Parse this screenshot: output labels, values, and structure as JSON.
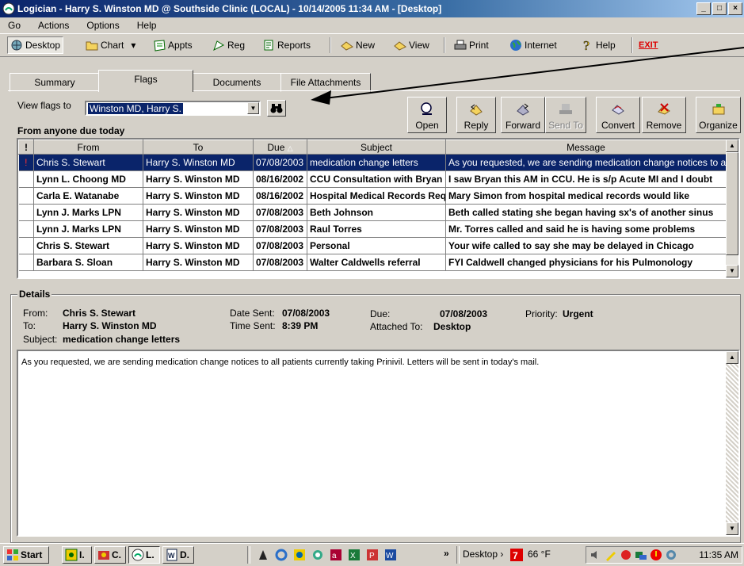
{
  "window": {
    "title": "Logician  -  Harry S. Winston MD @ Southside Clinic (LOCAL)  -  10/14/2005  11:34 AM - [Desktop]",
    "controls": [
      "_",
      "□",
      "×"
    ]
  },
  "menu": [
    "Go",
    "Actions",
    "Options",
    "Help"
  ],
  "toolbar": {
    "desktop": "Desktop",
    "chart": "Chart",
    "chart_dropdown": "▾",
    "appts": "Appts",
    "reg": "Reg",
    "reports": "Reports",
    "new": "New",
    "view": "View",
    "print": "Print",
    "internet": "Internet",
    "help": "Help",
    "exit": "EXIT"
  },
  "tabs": [
    "Summary",
    "Flags",
    "Documents",
    "File Attachments"
  ],
  "active_tab": "Flags",
  "filter": {
    "label": "View flags to",
    "value": "Winston MD, Harry S.",
    "caption": "From anyone due today"
  },
  "actions": [
    {
      "label": "Open",
      "icon": "open-icon",
      "enabled": true
    },
    {
      "label": "Reply",
      "icon": "reply-icon",
      "enabled": true
    },
    {
      "label": "Forward",
      "icon": "forward-icon",
      "enabled": true
    },
    {
      "label": "Send To",
      "icon": "send-to-icon",
      "enabled": false
    },
    {
      "label": "Convert",
      "icon": "convert-icon",
      "enabled": true
    },
    {
      "label": "Remove",
      "icon": "remove-icon",
      "enabled": true
    },
    {
      "label": "Organize",
      "icon": "organize-icon",
      "enabled": true
    }
  ],
  "grid": {
    "columns": [
      "!",
      "From",
      "To",
      "Due",
      "Subject",
      "Message"
    ],
    "sort_indicator": "△",
    "rows": [
      {
        "urgent": "!",
        "from": "Chris S. Stewart",
        "to": "Harry S. Winston MD",
        "due": "07/08/2003",
        "subject": "medication change letters",
        "message": "As you requested, we are sending medication change notices to all patients",
        "selected": true
      },
      {
        "urgent": "",
        "from": "Lynn L. Choong MD",
        "to": "Harry S. Winston MD",
        "due": "08/16/2002",
        "subject": "CCU Consultation with Bryan",
        "message": "I saw Bryan this AM in CCU. He is s/p Acute MI and I doubt",
        "selected": false
      },
      {
        "urgent": "",
        "from": "Carla E. Watanabe",
        "to": "Harry S. Winston MD",
        "due": "08/16/2002",
        "subject": "Hospital Medical Records Request",
        "message": "Mary Simon from hospital medical records would like",
        "selected": false
      },
      {
        "urgent": "",
        "from": "Lynn J. Marks LPN",
        "to": "Harry S. Winston MD",
        "due": "07/08/2003",
        "subject": "Beth Johnson",
        "message": "Beth called stating she began having sx's of another sinus",
        "selected": false
      },
      {
        "urgent": "",
        "from": "Lynn J. Marks LPN",
        "to": "Harry S. Winston MD",
        "due": "07/08/2003",
        "subject": "Raul Torres",
        "message": "Mr. Torres called and said he is having some problems",
        "selected": false
      },
      {
        "urgent": "",
        "from": "Chris S. Stewart",
        "to": "Harry S. Winston MD",
        "due": "07/08/2003",
        "subject": "Personal",
        "message": "Your wife called to say she may be delayed in Chicago",
        "selected": false
      },
      {
        "urgent": "",
        "from": "Barbara S. Sloan",
        "to": "Harry S. Winston MD",
        "due": "07/08/2003",
        "subject": "Walter Caldwells referral",
        "message": "FYI  Caldwell changed physicians for his Pulmonology",
        "selected": false
      }
    ]
  },
  "details": {
    "title": "Details",
    "from_label": "From:",
    "from": "Chris S. Stewart",
    "to_label": "To:",
    "to": "Harry S. Winston MD",
    "subject_label": "Subject:",
    "subject": "medication change letters",
    "date_sent_label": "Date Sent:",
    "date_sent": "07/08/2003",
    "time_sent_label": "Time Sent:",
    "time_sent": "8:39 PM",
    "due_label": "Due:",
    "due": "07/08/2003",
    "attached_label": "Attached To:",
    "attached": "Desktop",
    "priority_label": "Priority:",
    "priority": "Urgent",
    "body": "As you requested, we are sending medication change notices to all patients currently taking Prinivil.  Letters will be sent in today's mail."
  },
  "taskbar": {
    "start": "Start",
    "items": [
      "I.",
      "C.",
      "L.",
      "D."
    ],
    "overflow": "»",
    "desktop_toolbar": "Desktop",
    "desktop_chevron": "›",
    "weather": "66 °F",
    "clock": "11:35 AM"
  },
  "colors": {
    "selection": "#0a246a",
    "urgent": "#c00000",
    "titlebar_start": "#0a246a",
    "face": "#d4d0c8"
  }
}
